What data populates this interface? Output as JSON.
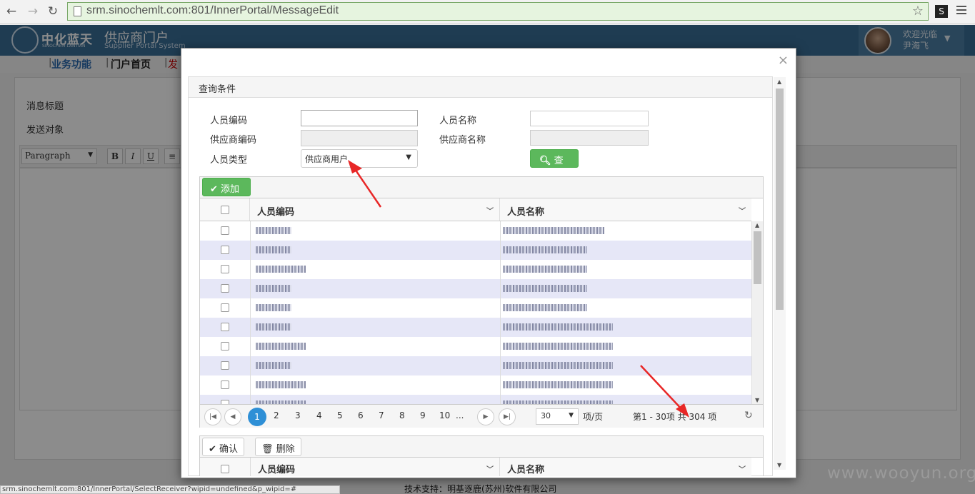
{
  "browser": {
    "url": "srm.sinochemlt.com:801/InnerPortal/MessageEdit",
    "ext_label": "S",
    "status_url": "srm.sinochemlt.com:801/InnerPortal/SelectReceiver?wipid=undefined&p_wipid=#"
  },
  "header": {
    "logo_cn": "中化蓝天",
    "logo_en": "SINOCHEM LANTIAN",
    "portal_cn": "供应商门户",
    "portal_en": "Supplier Portal System",
    "welcome": "欢迎光临",
    "username": "尹海飞"
  },
  "topnav": {
    "item1": "业务功能",
    "item2": "门户首页",
    "item3": "发"
  },
  "form": {
    "msg_title_label": "消息标题",
    "send_target_label": "发送对象",
    "editor_format": "Paragraph",
    "bold": "B",
    "italic": "I",
    "underline": "U"
  },
  "footer": {
    "support": "技术支持：明基逐鹿(苏州)软件有限公司",
    "watermark": "www.wooyun.org"
  },
  "dialog": {
    "close": "×",
    "panel_title": "查询条件",
    "emp_code_label": "人员编码",
    "emp_name_label": "人员名称",
    "supplier_code_label": "供应商编码",
    "supplier_name_label": "供应商名称",
    "emp_type_label": "人员类型",
    "emp_type_value": "供应商用户",
    "search_button": "查询",
    "add_button": "添加",
    "col_code": "人员编码",
    "col_name": "人员名称",
    "rows": [
      {
        "code_len": 50,
        "name_len": 142
      },
      {
        "code_len": 50,
        "name_len": 118
      },
      {
        "code_len": 70,
        "name_len": 118
      },
      {
        "code_len": 50,
        "name_len": 118
      },
      {
        "code_len": 50,
        "name_len": 118
      },
      {
        "code_len": 50,
        "name_len": 154
      },
      {
        "code_len": 70,
        "name_len": 154
      },
      {
        "code_len": 50,
        "name_len": 154
      },
      {
        "code_len": 70,
        "name_len": 154
      },
      {
        "code_len": 70,
        "name_len": 154
      }
    ],
    "pager": {
      "pages": [
        "4",
        "5",
        "6",
        "7",
        "8",
        "9",
        "10",
        "..."
      ],
      "info": "第1 - 30项 共 304 项"
    },
    "confirm_button": "确认",
    "delete_button": "删除"
  }
}
